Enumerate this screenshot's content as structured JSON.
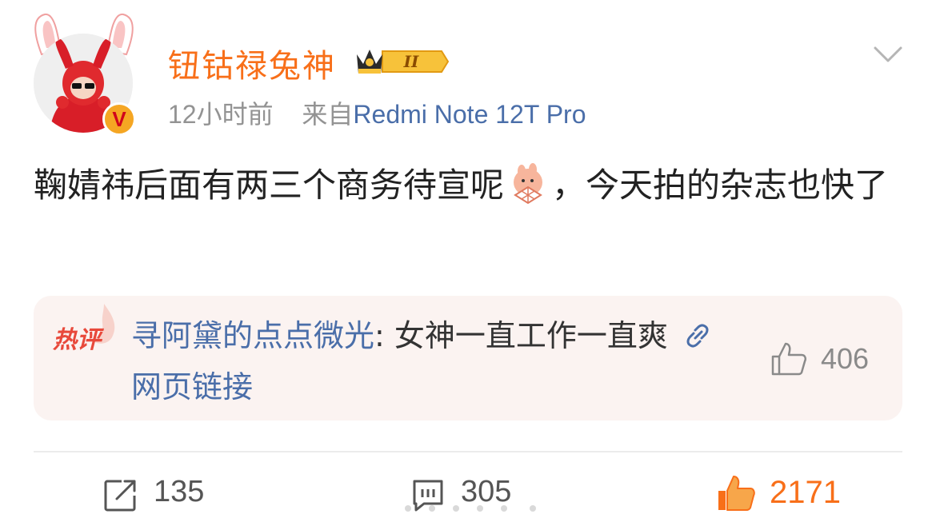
{
  "post": {
    "username": "钮钴禄兔神",
    "level_badge": "II",
    "time": "12小时前",
    "source_prefix": "来自",
    "source": "Redmi Note 12T Pro",
    "text_part1": "鞠婧祎后面有两三个商务待宣呢",
    "text_part2": "，今天拍的杂志也快了",
    "emoji_name": "shy-fan-emoji"
  },
  "hot_comment": {
    "label": "热评",
    "author": "寻阿黛的点点微光",
    "separator": ": ",
    "text": "女神一直工作一直爽",
    "link_icon": "link-icon",
    "link_text": "网页链接",
    "likes": "406"
  },
  "actions": {
    "reposts": "135",
    "comments": "305",
    "likes": "2171"
  },
  "colors": {
    "username": "#f86f19",
    "link": "#4a6ea9",
    "meta": "#939393",
    "card_bg": "#fbf3f1",
    "like_active": "#f86f19"
  },
  "icons": {
    "more": "chevron-down-icon",
    "verified": "verified-v-icon",
    "crown": "crown-icon",
    "comment_like": "thumbs-up-outline-icon",
    "repost": "repost-icon",
    "comment": "comment-icon",
    "like": "thumbs-up-filled-icon"
  }
}
